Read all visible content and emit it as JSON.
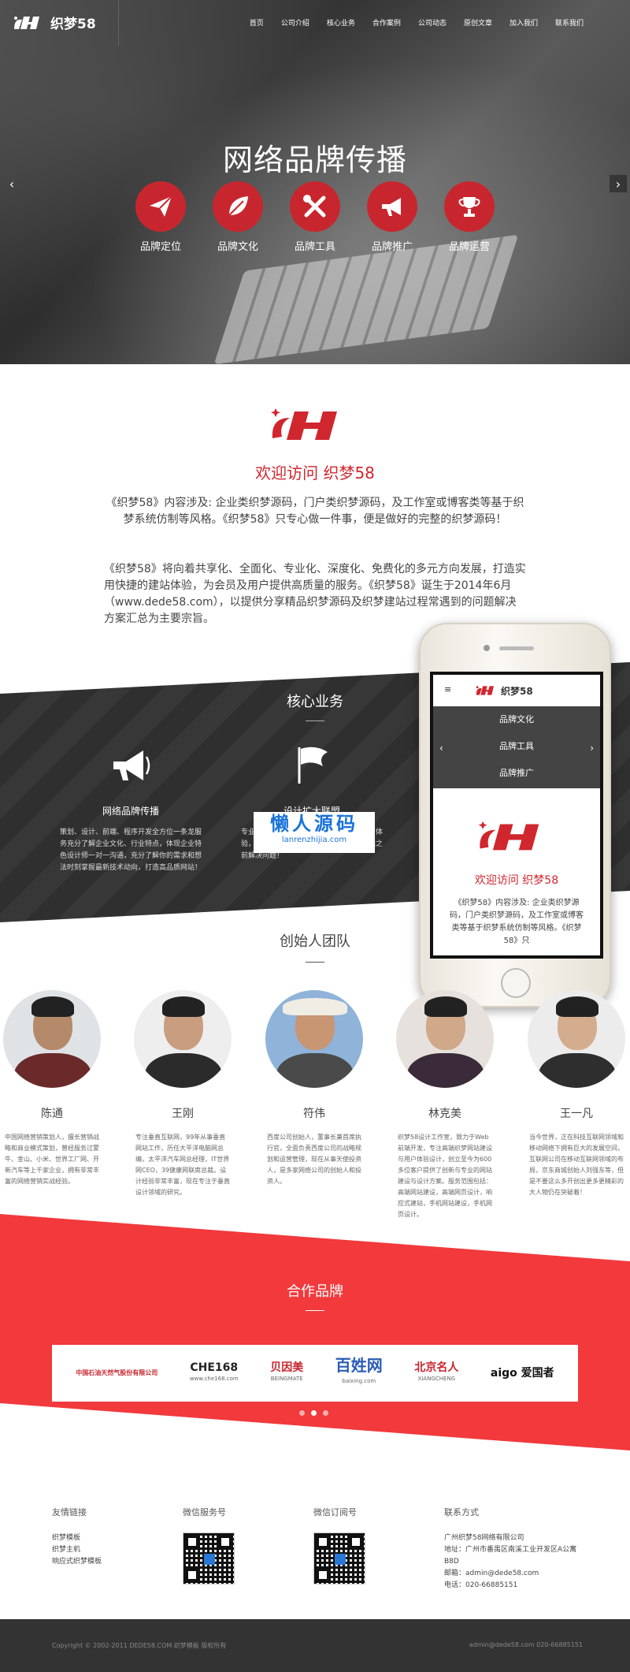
{
  "header": {
    "logo_text": "织梦58",
    "nav": [
      "首页",
      "公司介绍",
      "核心业务",
      "合作案例",
      "公司动态",
      "原创文章",
      "加入我们",
      "联系我们"
    ]
  },
  "hero": {
    "title": "网络品牌传播",
    "features": [
      {
        "label": "品牌定位",
        "icon": "paper-plane-icon"
      },
      {
        "label": "品牌文化",
        "icon": "leaf-icon"
      },
      {
        "label": "品牌工具",
        "icon": "tools-icon"
      },
      {
        "label": "品牌推广",
        "icon": "megaphone-icon"
      },
      {
        "label": "品牌运营",
        "icon": "trophy-icon"
      }
    ],
    "arrow_left": "‹",
    "arrow_right": "›"
  },
  "welcome": {
    "title": "欢迎访问 织梦58",
    "p1": "《织梦58》内容涉及: 企业类织梦源码，门户类织梦源码，及工作室或博客类等基于织梦系统仿制等风格。《织梦58》只专心做一件事，便是做好的完整的织梦源码！",
    "p2": "《织梦58》将向着共享化、全面化、专业化、深度化、免费化的多元方向发展，打造实用快捷的建站体验，为会员及用户提供高质量的服务。《织梦58》诞生于2014年6月（www.dede58.com），以提供分享精品织梦源码及织梦建站过程常遇到的问题解决方案汇总为主要宗旨。"
  },
  "core": {
    "title": "核心业务",
    "items": [
      {
        "name": "网络品牌传播",
        "desc": "策划、设计、前端、程序开发全方位一条龙服务充分了解企业文化、行业特点，体现企业特色设计师一对一沟通，充分了解你的需求和想法时刻掌握最新技术动向，打造高品质网站！"
      },
      {
        "name": "设计扩大联盟",
        "desc": "专业设计团队为您量身定制，不断提升用户体验，紧跟行业发展趋势，不断创新，在上线之前解决问题！"
      }
    ]
  },
  "phone": {
    "menu_icon": "≡",
    "logo_text": "织梦58",
    "menu_items": [
      "品牌文化",
      "品牌工具",
      "品牌推广"
    ],
    "title": "欢迎访问 织梦58",
    "text": "《织梦58》内容涉及: 企业类织梦源码，门户类织梦源码，及工作室或博客类等基于织梦系统仿制等风格。《织梦58》只",
    "arrow_left": "‹",
    "arrow_right": "›"
  },
  "watermark": {
    "line1": "懒人源码",
    "line2": "lanrenzhijia.com"
  },
  "team": {
    "title": "创始人团队",
    "members": [
      {
        "name": "陈通",
        "desc": "中国网络营销策划人，擅长营销战略和商业模式策划，曾经服务过蒙牛、金山、小米、世界工厂网、开新汽车等上千家企业，拥有非常丰富的网络营销实战经验。"
      },
      {
        "name": "王刚",
        "desc": "专注垂直互联网，99年从事垂直网站工作，历任大平洋电脑网总编，太平洋汽车网总经理，IT世界网CEO，39健康网联席总裁。设计经验非常丰富，现在专注于垂直设计领域的研究。"
      },
      {
        "name": "符伟",
        "desc": "西度公司创始人，董事长兼首席执行官，全面负责西度公司的战略规划和运营管理，现在从事天使投资人，是多家网络公司的创始人和投资人。"
      },
      {
        "name": "林克美",
        "desc": "织梦58设计工作室，致力于Web前端开发，专注高端织梦网站建设与用户体验设计，创立至今为600多位客户提供了创新与专业的网站建设与设计方案。服务范围包括：高端网站建设，高端网页设计，响应式建站，手机网站建设，手机网页设计。"
      },
      {
        "name": "王一凡",
        "desc": "当今世界，正在科技互联网领域和移动网络下拥有巨大的发展空间，互联网公司在移动互联网领域的布局，京东商城创始人刘强东等，但是不要这么多开创出更多更精彩的大人物仍在突破着！"
      }
    ]
  },
  "partners": {
    "title": "合作品牌",
    "brands": [
      {
        "name": "中国石油天然气股份有限公司",
        "sub": "",
        "color": "#c8262e"
      },
      {
        "name": "CHE168",
        "sub": "www.che168.com",
        "color": "#222222"
      },
      {
        "name": "贝因美",
        "sub": "BEINGMATE",
        "color": "#c8262e"
      },
      {
        "name": "百姓网",
        "sub": "baixing.com",
        "color": "#2a5bb5"
      },
      {
        "name": "北京名人",
        "sub": "XIANGCHENG",
        "color": "#c8262e"
      },
      {
        "name": "aigo 爱国者",
        "sub": "",
        "color": "#111111"
      }
    ]
  },
  "footer": {
    "links_title": "友情链接",
    "links": [
      "织梦模板",
      "织梦主机",
      "响应式织梦模板"
    ],
    "wechat_service_title": "微信服务号",
    "wechat_sub_title": "微信订阅号",
    "contact_title": "联系方式",
    "contact": [
      "广州织梦58网络有限公司",
      "地址：广州市番禺区南溪工业开发区A公寓B8D",
      "邮箱：admin@dede58.com",
      "电话：020-66885151"
    ],
    "copyright_left": "Copyright © 2002-2011 DEDE58.COM 织梦模板 版权所有",
    "copyright_right": "admin@dede58.com  020-66885151"
  },
  "colors": {
    "brand_red": "#c8262e",
    "partners_bg": "#f2393c",
    "dark_band": "#2f2f2f"
  }
}
